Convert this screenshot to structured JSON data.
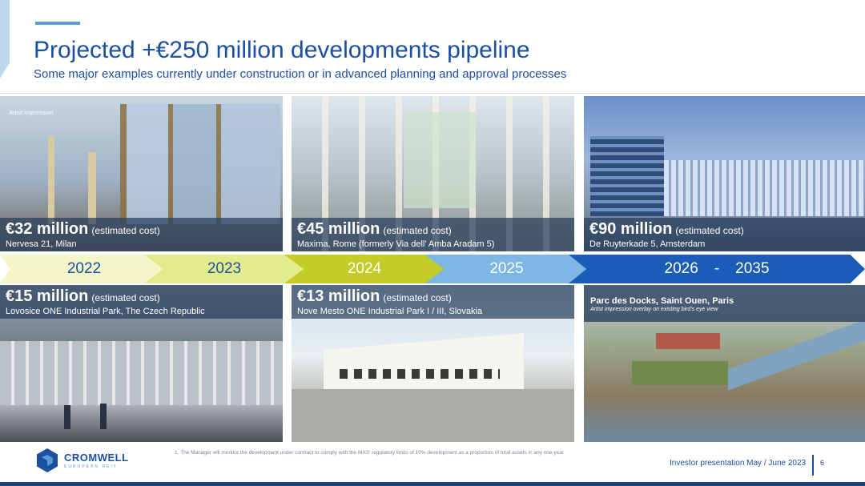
{
  "header": {
    "title": "Projected +€250 million developments pipeline",
    "subtitle": "Some major examples currently under construction or in advanced planning and approval processes"
  },
  "projects_top": [
    {
      "amount": "€32 million",
      "est": "(estimated cost)",
      "location": "Nervesa 21, Milan",
      "note": "Artist impression"
    },
    {
      "amount": "€45 million",
      "est": "(estimated cost)",
      "location": "Maxima, Rome (formerly Via dell' Amba Aradam 5)"
    },
    {
      "amount": "€90 million",
      "est": "(estimated cost)",
      "location": "De Ruyterkade 5, Amsterdam"
    }
  ],
  "projects_bottom": [
    {
      "amount": "€15 million",
      "est": "(estimated cost)",
      "location": "Lovosice ONE Industrial Park, The Czech Republic"
    },
    {
      "amount": "€13 million",
      "est": "(estimated cost)",
      "location": "Nove Mesto ONE Industrial Park I / III, Slovakia"
    },
    {
      "title": "Parc des Docks, Saint Ouen, Paris",
      "note": "Artist impression overlay on existing bird's eye view"
    }
  ],
  "timeline": {
    "years": [
      "2022",
      "2023",
      "2024",
      "2025"
    ],
    "range_start": "2026",
    "range_sep": "-",
    "range_end": "2035"
  },
  "footer": {
    "logo_name": "CROMWELL",
    "logo_sub": "EUROPEAN REIT",
    "footnote": "1.    The Manager will monitor the development under contract to comply with the MAS' regulatory limits of 10% development as a proportion of total assets in any one year",
    "investor_label": "Investor presentation May / June 2023",
    "page_number": "6"
  },
  "colors": {
    "brand_blue": "#1c4fa0",
    "accent_light_blue": "#5b9bd5",
    "timeline": [
      "#f3f6c8",
      "#e3ec8c",
      "#c4cc28",
      "#7db7e6",
      "#1b5cb8"
    ]
  }
}
